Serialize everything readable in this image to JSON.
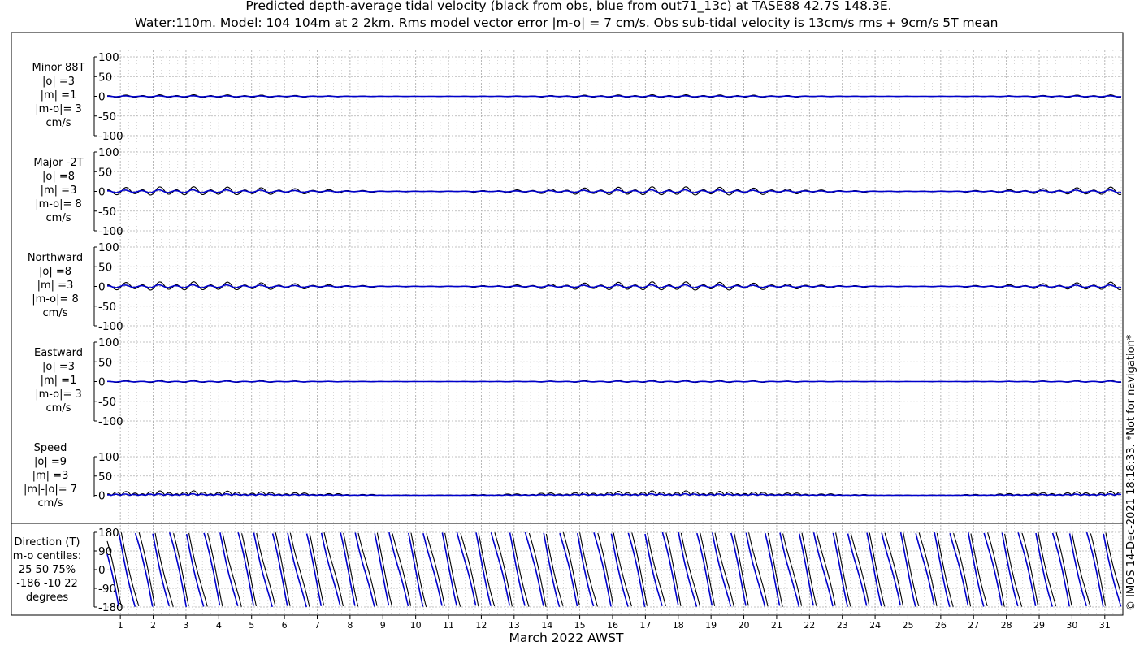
{
  "title_line1": "Predicted depth-average tidal velocity (black from obs, blue from out71_13c) at TASE88 42.7S 148.3E.",
  "title_line2": "Water:110m. Model: 104 104m at 2 2km. Rms model vector error |m-o| = 7 cm/s. Obs sub-tidal velocity is 13cm/s rms + 9cm/s 5T mean",
  "xlabel": "March 2022 AWST",
  "watermark": "© IMOS 14-Dec-2021 18:18:33. *Not for navigation*",
  "colors": {
    "obs": "#000000",
    "model": "#0000cc",
    "grid": "#b0b0b0"
  },
  "chart_data": [
    {
      "type": "line",
      "name": "minor",
      "label_lines": [
        "Minor 88T",
        "|o| =3",
        "|m| =1",
        "|m-o|= 3",
        "cm/s"
      ],
      "yticks": [
        "100",
        "50",
        "0",
        "-50",
        "-100"
      ],
      "ylim": [
        -100,
        100
      ],
      "x": {
        "start_day": 0.6,
        "end_day": 31.5,
        "unit": "day of March 2022"
      },
      "series": [
        {
          "role": "observed",
          "color": "#000000",
          "semidiurnal_amp": 3,
          "diurnal_amp": 1,
          "offset": 0
        },
        {
          "role": "model",
          "color": "#0000cc",
          "semidiurnal_amp": 1,
          "diurnal_amp": 0.5,
          "offset": 0
        }
      ]
    },
    {
      "type": "line",
      "name": "major",
      "label_lines": [
        "Major -2T",
        "|o| =8",
        "|m| =3",
        "|m-o|= 8",
        "cm/s"
      ],
      "yticks": [
        "100",
        "50",
        "0",
        "-50",
        "-100"
      ],
      "ylim": [
        -100,
        100
      ],
      "x": {
        "start_day": 0.6,
        "end_day": 31.5,
        "unit": "day of March 2022"
      },
      "series": [
        {
          "role": "observed",
          "color": "#000000",
          "semidiurnal_amp": 8,
          "diurnal_amp": 4,
          "offset": 0
        },
        {
          "role": "model",
          "color": "#0000cc",
          "semidiurnal_amp": 3,
          "diurnal_amp": 1,
          "offset": 0
        }
      ]
    },
    {
      "type": "line",
      "name": "northward",
      "label_lines": [
        "Northward",
        "|o| =8",
        "|m| =3",
        "|m-o|= 8",
        "cm/s"
      ],
      "yticks": [
        "100",
        "50",
        "0",
        "-50",
        "-100"
      ],
      "ylim": [
        -100,
        100
      ],
      "x": {
        "start_day": 0.6,
        "end_day": 31.5,
        "unit": "day of March 2022"
      },
      "series": [
        {
          "role": "observed",
          "color": "#000000",
          "semidiurnal_amp": 8,
          "diurnal_amp": 4,
          "offset": 0
        },
        {
          "role": "model",
          "color": "#0000cc",
          "semidiurnal_amp": 3,
          "diurnal_amp": 1,
          "offset": 0
        }
      ]
    },
    {
      "type": "line",
      "name": "eastward",
      "label_lines": [
        "Eastward",
        "|o| =3",
        "|m| =1",
        "|m-o|= 3",
        "cm/s"
      ],
      "yticks": [
        "100",
        "50",
        "0",
        "-50",
        "-100"
      ],
      "ylim": [
        -100,
        100
      ],
      "x": {
        "start_day": 0.6,
        "end_day": 31.5,
        "unit": "day of March 2022"
      },
      "series": [
        {
          "role": "observed",
          "color": "#000000",
          "semidiurnal_amp": 2,
          "diurnal_amp": 1,
          "offset": 0
        },
        {
          "role": "model",
          "color": "#0000cc",
          "semidiurnal_amp": 1,
          "diurnal_amp": 0.5,
          "offset": 0
        }
      ]
    },
    {
      "type": "line",
      "name": "speed",
      "label_lines": [
        "Speed",
        "|o| =9",
        "|m| =3",
        "|m|-|o|= 7",
        "cm/s"
      ],
      "yticks": [
        "100",
        "50",
        "0"
      ],
      "ylim": [
        -3,
        100
      ],
      "x": {
        "start_day": 0.6,
        "end_day": 31.5,
        "unit": "day of March 2022"
      },
      "series": [
        {
          "role": "observed",
          "color": "#000000",
          "semidiurnal_amp": 8,
          "diurnal_amp": 4,
          "offset": 0
        },
        {
          "role": "model",
          "color": "#0000cc",
          "semidiurnal_amp": 3,
          "diurnal_amp": 1,
          "offset": 0
        }
      ]
    },
    {
      "type": "line",
      "name": "direction",
      "label_lines": [
        "Direction (T)",
        "m-o centiles:",
        "25  50  75%",
        "-186  -10   22",
        "degrees"
      ],
      "yticks": [
        "180",
        "90",
        "0",
        "-90",
        "-180"
      ],
      "ylim": [
        -180,
        180
      ],
      "x": {
        "start_day": 0.6,
        "end_day": 31.5,
        "unit": "day of March 2022"
      },
      "series": [
        {
          "role": "observed",
          "color": "#000000",
          "wraps": true
        },
        {
          "role": "model",
          "color": "#0000cc",
          "wraps": true
        }
      ]
    }
  ],
  "xticks": [
    "1",
    "2",
    "3",
    "4",
    "5",
    "6",
    "7",
    "8",
    "9",
    "10",
    "11",
    "12",
    "13",
    "14",
    "15",
    "16",
    "17",
    "18",
    "19",
    "20",
    "21",
    "22",
    "23",
    "24",
    "25",
    "26",
    "27",
    "28",
    "29",
    "30",
    "31"
  ]
}
